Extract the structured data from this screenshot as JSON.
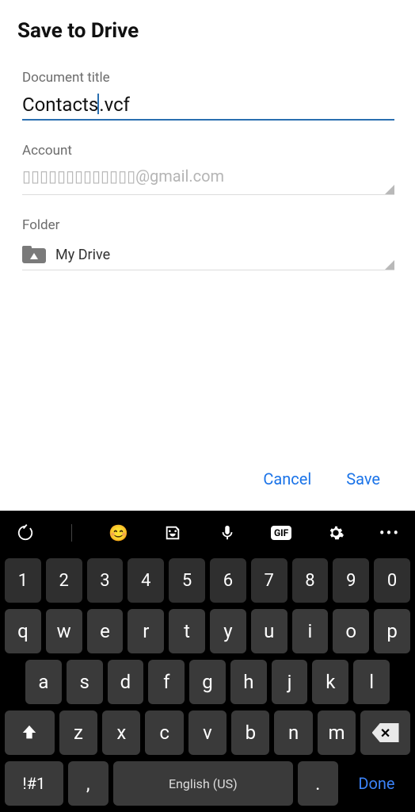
{
  "dialog": {
    "title": "Save to Drive",
    "document_title_label": "Document title",
    "document_title_value_before": "Contacts",
    "document_title_value_after": ".vcf",
    "account_label": "Account",
    "account_value": "▯▯▯▯▯▯▯▯▯▯▯▯▯@gmail.com",
    "folder_label": "Folder",
    "folder_value": "My Drive",
    "cancel_label": "Cancel",
    "save_label": "Save"
  },
  "keyboard": {
    "num_row": [
      "1",
      "2",
      "3",
      "4",
      "5",
      "6",
      "7",
      "8",
      "9",
      "0"
    ],
    "row1": [
      "q",
      "w",
      "e",
      "r",
      "t",
      "y",
      "u",
      "i",
      "o",
      "p"
    ],
    "row2": [
      "a",
      "s",
      "d",
      "f",
      "g",
      "h",
      "j",
      "k",
      "l"
    ],
    "row3": [
      "z",
      "x",
      "c",
      "v",
      "b",
      "n",
      "m"
    ],
    "sym_label": "!#1",
    "comma_label": ",",
    "space_label": "English (US)",
    "dot_label": ".",
    "done_label": "Done",
    "gif_label": "GIF"
  }
}
